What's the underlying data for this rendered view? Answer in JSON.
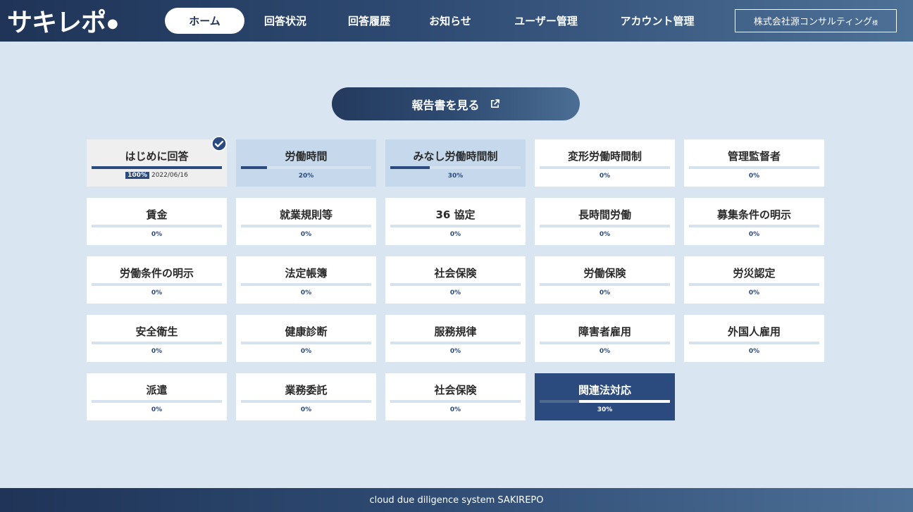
{
  "header": {
    "logo_text": "サキレポ",
    "logo_dot": "●",
    "nav": [
      {
        "label": "ホーム",
        "active": true
      },
      {
        "label": "回答状況",
        "active": false
      },
      {
        "label": "回答履歴",
        "active": false
      },
      {
        "label": "お知らせ",
        "active": false
      },
      {
        "label": "ユーザー管理",
        "active": false
      },
      {
        "label": "アカウント管理",
        "active": false
      }
    ],
    "company": "株式会社源コンサルティング",
    "company_suffix": "様"
  },
  "report_button": {
    "label": "報告書を見る",
    "icon": "external-link-icon"
  },
  "cards": [
    {
      "title": "はじめに回答",
      "progress": 100,
      "pct": "100%",
      "date": "2022/06/16",
      "state": "done",
      "checked": true
    },
    {
      "title": "労働時間",
      "progress": 20,
      "pct": "20%",
      "state": "progress"
    },
    {
      "title": "みなし労働時間制",
      "progress": 30,
      "pct": "30%",
      "state": "progress"
    },
    {
      "title": "変形労働時間制",
      "progress": 0,
      "pct": "0%",
      "state": "empty"
    },
    {
      "title": "管理監督者",
      "progress": 0,
      "pct": "0%",
      "state": "empty"
    },
    {
      "title": "賃金",
      "progress": 0,
      "pct": "0%",
      "state": "empty"
    },
    {
      "title": "就業規則等",
      "progress": 0,
      "pct": "0%",
      "state": "empty"
    },
    {
      "title": "36 協定",
      "progress": 0,
      "pct": "0%",
      "state": "empty"
    },
    {
      "title": "長時間労働",
      "progress": 0,
      "pct": "0%",
      "state": "empty"
    },
    {
      "title": "募集条件の明示",
      "progress": 0,
      "pct": "0%",
      "state": "empty"
    },
    {
      "title": "労働条件の明示",
      "progress": 0,
      "pct": "0%",
      "state": "empty"
    },
    {
      "title": "法定帳簿",
      "progress": 0,
      "pct": "0%",
      "state": "empty"
    },
    {
      "title": "社会保険",
      "progress": 0,
      "pct": "0%",
      "state": "empty"
    },
    {
      "title": "労働保険",
      "progress": 0,
      "pct": "0%",
      "state": "empty"
    },
    {
      "title": "労災認定",
      "progress": 0,
      "pct": "0%",
      "state": "empty"
    },
    {
      "title": "安全衛生",
      "progress": 0,
      "pct": "0%",
      "state": "empty"
    },
    {
      "title": "健康診断",
      "progress": 0,
      "pct": "0%",
      "state": "empty"
    },
    {
      "title": "服務規律",
      "progress": 0,
      "pct": "0%",
      "state": "empty"
    },
    {
      "title": "障害者雇用",
      "progress": 0,
      "pct": "0%",
      "state": "empty"
    },
    {
      "title": "外国人雇用",
      "progress": 0,
      "pct": "0%",
      "state": "empty"
    },
    {
      "title": "派遣",
      "progress": 0,
      "pct": "0%",
      "state": "empty"
    },
    {
      "title": "業務委託",
      "progress": 0,
      "pct": "0%",
      "state": "empty"
    },
    {
      "title": "社会保険",
      "progress": 0,
      "pct": "0%",
      "state": "empty"
    },
    {
      "title": "関連法対応",
      "progress": 70,
      "pct": "30%",
      "state": "dark"
    }
  ],
  "footer": {
    "text": "cloud due diligence system SAKIREPO"
  },
  "colors": {
    "navy": "#2b4a7e",
    "header_start": "#1f3457",
    "header_end": "#4d7096",
    "background": "#d9e5f1"
  }
}
